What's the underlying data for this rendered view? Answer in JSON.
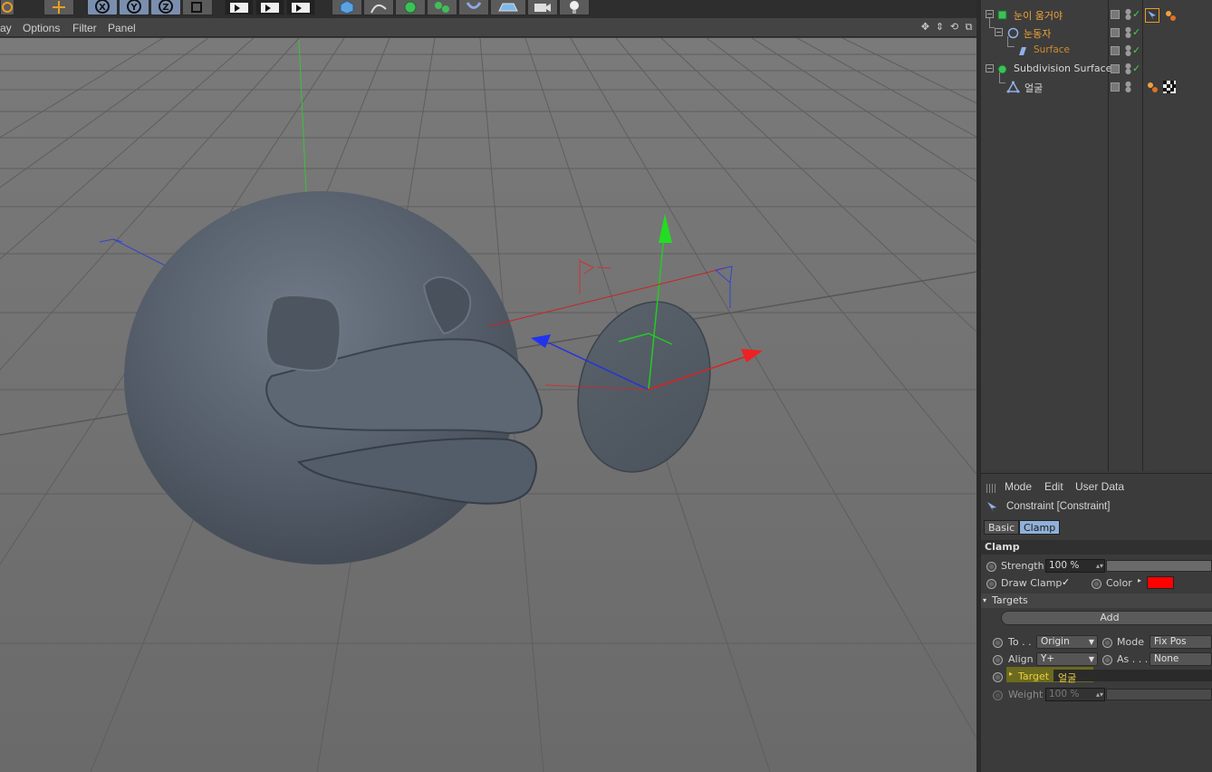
{
  "viewport_menu": {
    "items": [
      "ay",
      "Options",
      "Filter",
      "Panel"
    ]
  },
  "toolbar": {
    "axis_buttons": [
      "X",
      "Y",
      "Z"
    ]
  },
  "object_manager": {
    "objects": [
      {
        "name": "눈이 움거야",
        "color": "orange",
        "depth": 0
      },
      {
        "name": "눈동자",
        "color": "orange",
        "depth": 1
      },
      {
        "name": "Surface",
        "color": "orange",
        "depth": 2
      },
      {
        "name": "Subdivision Surface",
        "color": "white",
        "depth": 0
      },
      {
        "name": "얼굴",
        "color": "white",
        "depth": 1
      }
    ]
  },
  "attribute_manager": {
    "menu": [
      "Mode",
      "Edit",
      "User Data"
    ],
    "object_title": "Constraint [Constraint]",
    "tabs": [
      "Basic",
      "Clamp"
    ],
    "active_tab": "Clamp",
    "section": "Clamp",
    "strength_label": "Strength",
    "strength_value": "100 %",
    "draw_clamp_label": "Draw Clamp",
    "draw_clamp_checked": "✓",
    "color_label": "Color",
    "color_value": "#ff0000",
    "targets_label": "Targets",
    "add_label": "Add",
    "to_label": "To . .",
    "to_value": "Origin",
    "mode_label": "Mode",
    "mode_value": "Fix Pos",
    "align_label": "Align",
    "align_value": "Y+",
    "as_label": "As . . .",
    "as_value": "None",
    "target_label": "Target",
    "target_value": "얼굴",
    "weight_label": "Weight",
    "weight_value": "100 %"
  }
}
